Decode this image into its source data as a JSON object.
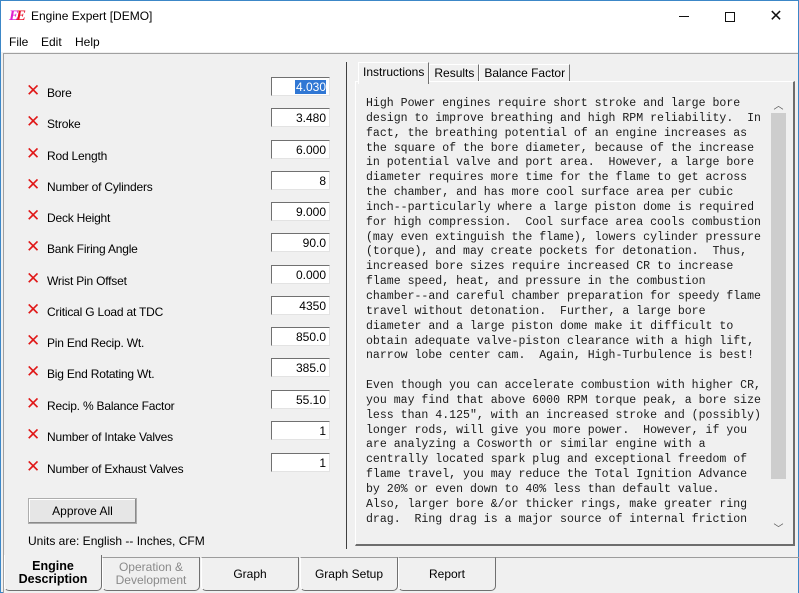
{
  "window": {
    "title": "Engine Expert  [DEMO]",
    "icon": "EE",
    "controls": {
      "minimize": "minimize-icon",
      "maximize": "maximize-icon",
      "close": "close-icon"
    }
  },
  "menu": [
    "File",
    "Edit",
    "Help"
  ],
  "parameters": [
    {
      "label": "Bore",
      "value": "4.030",
      "status_icon": "x-icon",
      "selected": true
    },
    {
      "label": "Stroke",
      "value": "3.480",
      "status_icon": "x-icon"
    },
    {
      "label": "Rod Length",
      "value": "6.000",
      "status_icon": "x-icon"
    },
    {
      "label": "Number of Cylinders",
      "value": "8",
      "status_icon": "x-icon"
    },
    {
      "label": "Deck Height",
      "value": "9.000",
      "status_icon": "x-icon"
    },
    {
      "label": "Bank Firing Angle",
      "value": "90.0",
      "status_icon": "x-icon"
    },
    {
      "label": "Wrist Pin Offset",
      "value": "0.000",
      "status_icon": "x-icon"
    },
    {
      "label": "Critical G Load at TDC",
      "value": "4350",
      "status_icon": "x-icon"
    },
    {
      "label": "Pin End Recip. Wt.",
      "value": "850.0",
      "status_icon": "x-icon"
    },
    {
      "label": "Big End Rotating Wt.",
      "value": "385.0",
      "status_icon": "x-icon"
    },
    {
      "label": "Recip. % Balance Factor",
      "value": "55.10",
      "status_icon": "x-icon"
    },
    {
      "label": "Number of Intake Valves",
      "value": "1",
      "status_icon": "x-icon"
    },
    {
      "label": "Number of Exhaust Valves",
      "value": "1",
      "status_icon": "x-icon"
    }
  ],
  "approve_button": "Approve All",
  "units_text": "Units are:  English -- Inches, CFM",
  "info_tabs": [
    {
      "label": "Instructions",
      "active": true
    },
    {
      "label": "Results",
      "active": false
    },
    {
      "label": "Balance Factor",
      "active": false
    }
  ],
  "instructions_text": "High Power engines require short stroke and large bore\ndesign to improve breathing and high RPM reliability.  In\nfact, the breathing potential of an engine increases as\nthe square of the bore diameter, because of the increase\nin potential valve and port area.  However, a large bore\ndiameter requires more time for the flame to get across\nthe chamber, and has more cool surface area per cubic\ninch--particularly where a large piston dome is required\nfor high compression.  Cool surface area cools combustion\n(may even extinguish the flame), lowers cylinder pressure\n(torque), and may create pockets for detonation.  Thus,\nincreased bore sizes require increased CR to increase\nflame speed, heat, and pressure in the combustion\nchamber--and careful chamber preparation for speedy flame\ntravel without detonation.  Further, a large bore\ndiameter and a large piston dome make it difficult to\nobtain adequate valve-piston clearance with a high lift,\nnarrow lobe center cam.  Again, High-Turbulence is best!\n\nEven though you can accelerate combustion with higher CR,\nyou may find that above 6000 RPM torque peak, a bore size\nless than 4.125\", with an increased stroke and (possibly)\nlonger rods, will give you more power.  However, if you\nare analyzing a Cosworth or similar engine with a\ncentrally located spark plug and exceptional freedom of\nflame travel, you may reduce the Total Ignition Advance\nby 20% or even down to 40% less than default value.\nAlso, larger bore &/or thicker rings, make greater ring\ndrag.  Ring drag is a major source of internal friction",
  "scrollbar": {
    "up": "chevron-up-icon",
    "down": "chevron-down-icon"
  },
  "bottom_tabs": [
    {
      "label": "Engine\nDescription",
      "active": true,
      "disabled": false
    },
    {
      "label": "Operation &\nDevelopment",
      "active": false,
      "disabled": true
    },
    {
      "label": "Graph",
      "active": false,
      "disabled": false
    },
    {
      "label": "Graph Setup",
      "active": false,
      "disabled": false
    },
    {
      "label": "Report",
      "active": false,
      "disabled": false
    }
  ]
}
